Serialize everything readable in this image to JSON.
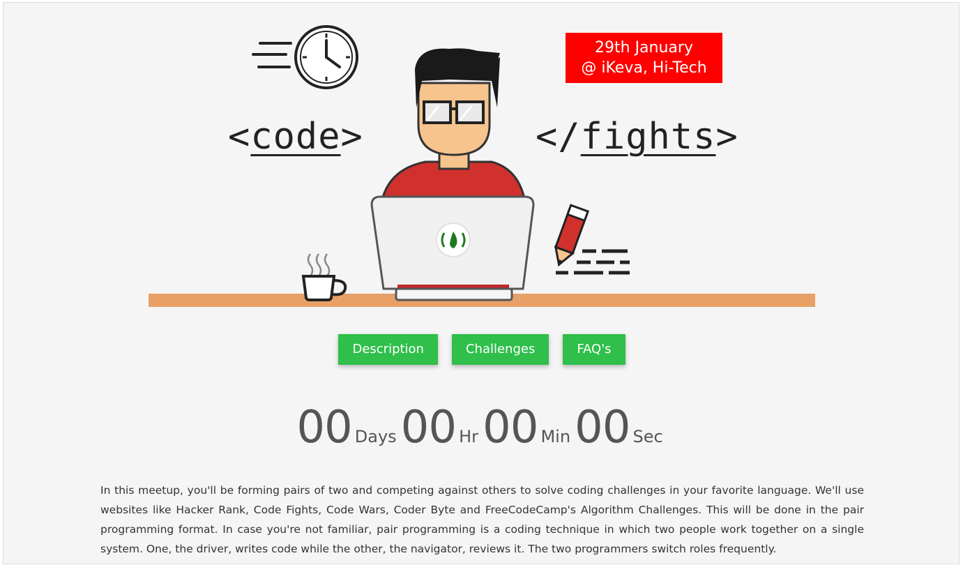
{
  "hero": {
    "date_line1": "29th January",
    "date_line2": "@ iKeva, Hi-Tech",
    "code_word_open": "<",
    "code_word": "code",
    "code_word_close": ">",
    "fights_word_open": "</",
    "fights_word": "fights",
    "fights_word_close": ">",
    "icons": [
      "clock-icon",
      "programmer-illustration",
      "laptop-icon",
      "freecodecamp-logo",
      "coffee-cup-icon",
      "pencil-icon"
    ]
  },
  "nav": {
    "description": "Description",
    "challenges": "Challenges",
    "faqs": "FAQ's"
  },
  "countdown": {
    "days_value": "00",
    "days_label": "Days",
    "hours_value": "00",
    "hours_label": "Hr",
    "minutes_value": "00",
    "minutes_label": "Min",
    "seconds_value": "00",
    "seconds_label": "Sec"
  },
  "description": {
    "text": "In this meetup, you'll be forming pairs of two and competing against others to solve coding challenges in your favorite language. We'll use websites like Hacker Rank, Code Fights, Code Wars, Coder Byte and FreeCodeCamp's Algorithm Challenges. This will be done in the pair programming format. In case you're not familiar, pair programming is a coding technique in which two people work together on a single system. One, the driver, writes code while the other, the navigator, reviews it. The two programmers switch roles frequently."
  },
  "colors": {
    "accent": "#2fbf4a",
    "date_badge": "#ff0000",
    "desk": "#e8a066",
    "shirt": "#d0312d"
  }
}
